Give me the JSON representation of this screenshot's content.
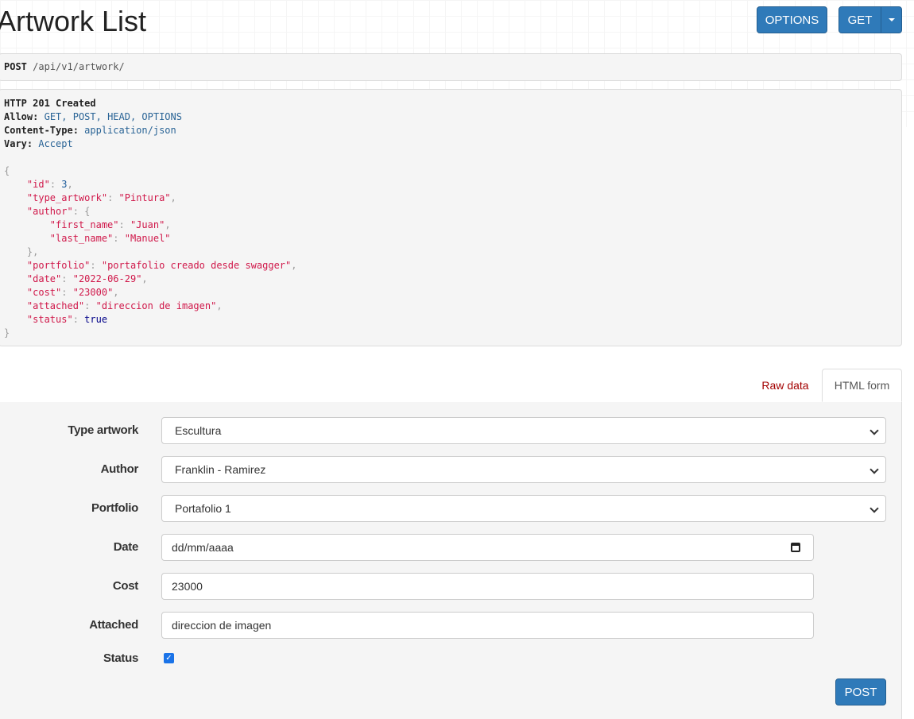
{
  "page": {
    "title": "Artwork List"
  },
  "toolbar": {
    "options_label": "OPTIONS",
    "get_label": "GET"
  },
  "request": {
    "method": "POST",
    "path": "/api/v1/artwork/"
  },
  "response": {
    "status_line": "HTTP 201 Created",
    "headers": [
      {
        "name": "Allow:",
        "value": "GET, POST, HEAD, OPTIONS"
      },
      {
        "name": "Content-Type:",
        "value": "application/json"
      },
      {
        "name": "Vary:",
        "value": "Accept"
      }
    ],
    "body": {
      "id_key": "\"id\"",
      "id_val": "3",
      "type_key": "\"type_artwork\"",
      "type_val": "\"Pintura\"",
      "author_key": "\"author\"",
      "first_name_key": "\"first_name\"",
      "first_name_val": "\"Juan\"",
      "last_name_key": "\"last_name\"",
      "last_name_val": "\"Manuel\"",
      "portfolio_key": "\"portfolio\"",
      "portfolio_val": "\"portafolio creado desde swagger\"",
      "date_key": "\"date\"",
      "date_val": "\"2022-06-29\"",
      "cost_key": "\"cost\"",
      "cost_val": "\"23000\"",
      "attached_key": "\"attached\"",
      "attached_val": "\"direccion de imagen\"",
      "status_key": "\"status\"",
      "status_val": "true"
    }
  },
  "tabs": {
    "raw_label": "Raw data",
    "html_label": "HTML form"
  },
  "form": {
    "type_artwork": {
      "label": "Type artwork",
      "value": "Escultura"
    },
    "author": {
      "label": "Author",
      "value": "Franklin - Ramirez"
    },
    "portfolio": {
      "label": "Portfolio",
      "value": "Portafolio 1"
    },
    "date": {
      "label": "Date",
      "placeholder": "dd/mm/aaaa"
    },
    "cost": {
      "label": "Cost",
      "value": "23000"
    },
    "attached": {
      "label": "Attached",
      "value": "direccion de imagen"
    },
    "status": {
      "label": "Status",
      "checked": true
    },
    "submit_label": "POST"
  },
  "colors": {
    "primary_button": "#2f7ab9",
    "raw_tab_text": "#a30000",
    "json_string": "#d0184a",
    "header_value": "#2a6496"
  }
}
